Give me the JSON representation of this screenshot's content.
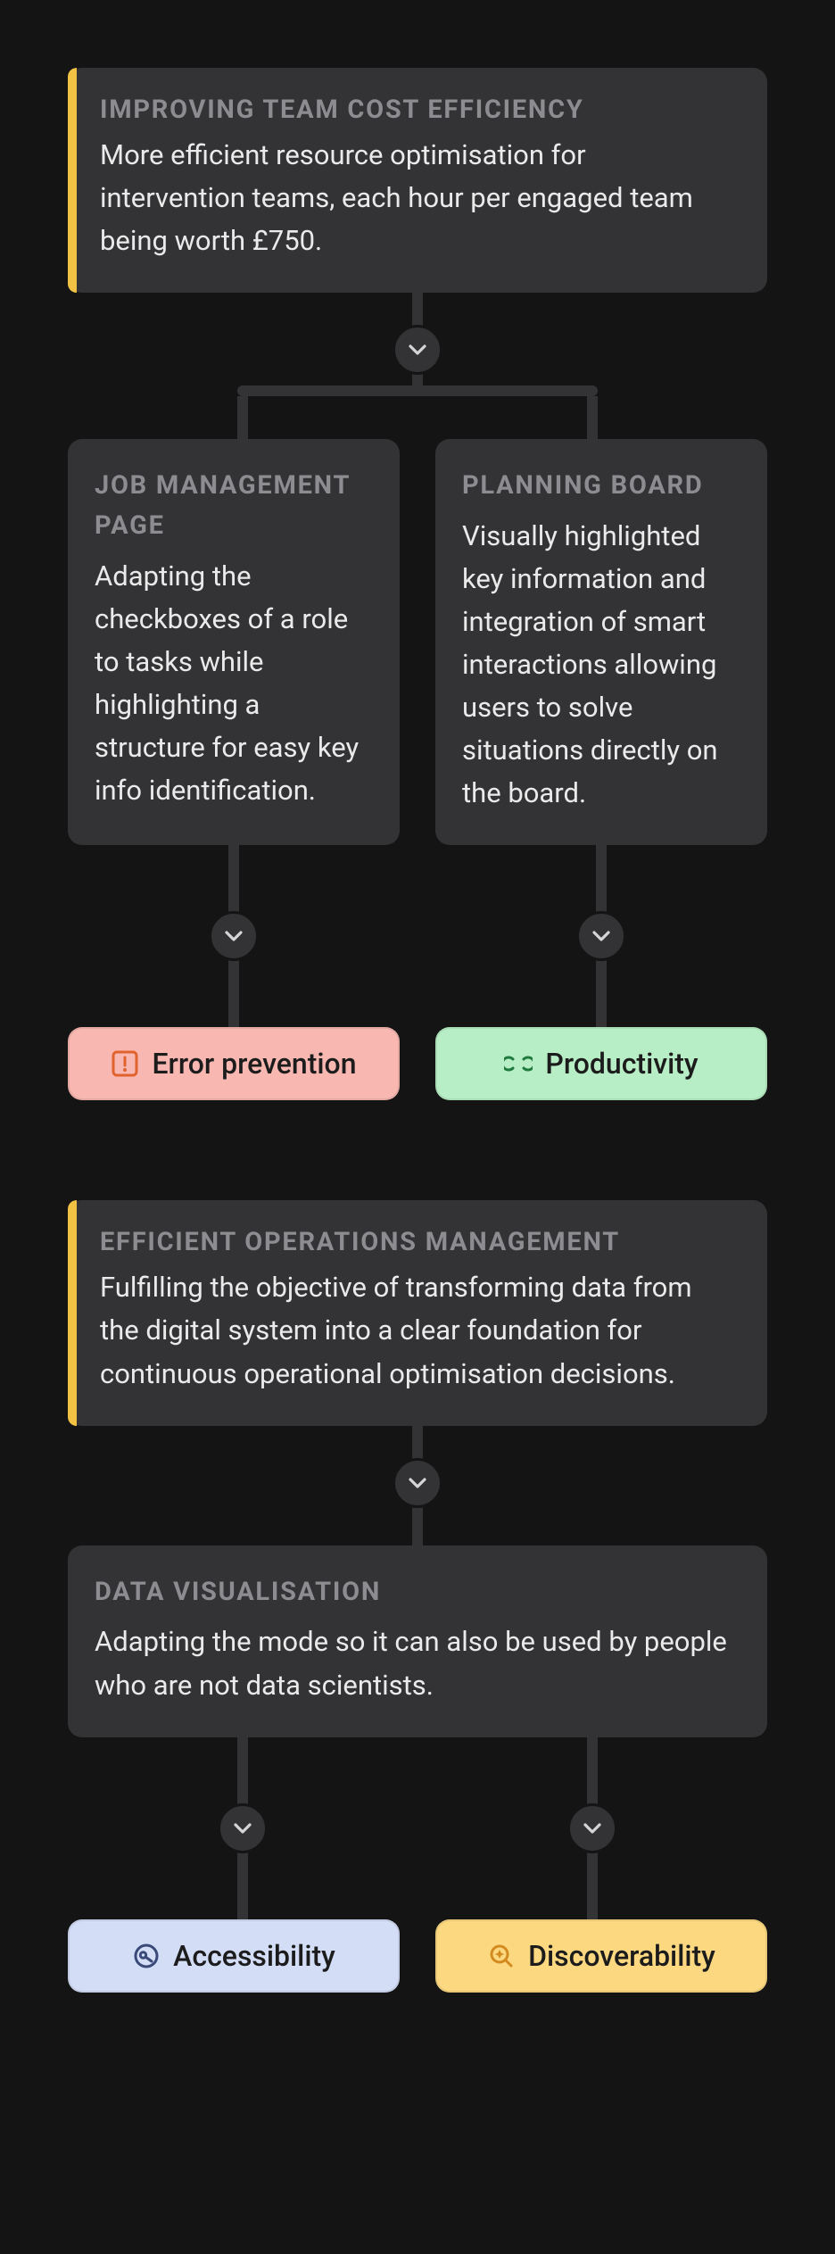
{
  "sections": [
    {
      "root": {
        "title": "IMPROVING TEAM COST EFFICIENCY",
        "body": "More efficient resource optimisation for intervention teams, each hour per engaged team being worth £750."
      },
      "children": [
        {
          "title": "JOB MANAGEMENT PAGE",
          "body": "Adapting the checkboxes of a role to tasks while highlighting a structure for easy key info identification.",
          "tag": {
            "label": "Error prevention",
            "kind": "error",
            "icon": "alert-square"
          }
        },
        {
          "title": "PLANNING BOARD",
          "body": "Visually highlighted key information and integration of smart interactions allowing users to solve situations directly on the board.",
          "tag": {
            "label": "Productivity",
            "kind": "prod",
            "icon": "link-loop"
          }
        }
      ]
    },
    {
      "root": {
        "title": "EFFICIENT OPERATIONS MANAGEMENT",
        "body": "Fulfilling the objective of transforming data from the digital system into a clear foundation for continuous operational optimisation decisions."
      },
      "children": [
        {
          "title": "DATA VISUALISATION",
          "body": "Adapting the mode so it can also be used by people who are not data scientists.",
          "tags": [
            {
              "label": "Accessibility",
              "kind": "acc",
              "icon": "key-circle"
            },
            {
              "label": "Discoverability",
              "kind": "disc",
              "icon": "sparkle-lens"
            }
          ]
        }
      ]
    }
  ],
  "icons": {
    "chevron-down": "chevron-down",
    "alert-square": "alert-square",
    "link-loop": "link-loop",
    "key-circle": "key-circle",
    "sparkle-lens": "sparkle-lens"
  },
  "colors": {
    "bg": "#141414",
    "card": "#333335",
    "accent": "#f1c244",
    "muted": "#8d8d91",
    "text": "#eaeaea",
    "tag_error": "#f8b7b1",
    "tag_prod": "#b8eec5",
    "tag_acc": "#d3ddf6",
    "tag_disc": "#fcd981"
  }
}
